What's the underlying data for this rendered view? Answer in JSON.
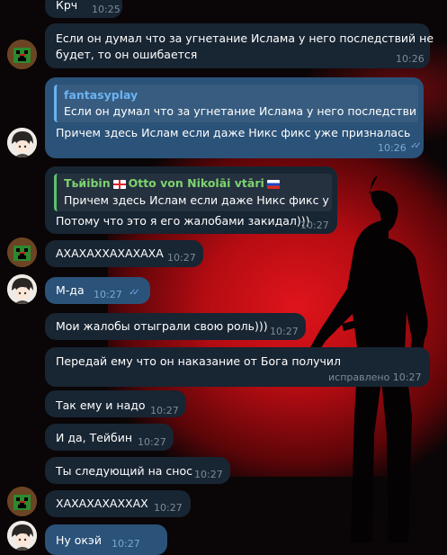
{
  "chat": {
    "messages": [
      {
        "text": "Крч",
        "time": "10:25"
      },
      {
        "text_line1": "Если он думал что за угнетание Ислама у него последствий не",
        "text_line2": "будет, то он ошибается",
        "time": "10:26"
      },
      {
        "reply_name": "fantasyplay",
        "reply_text": "Если он думал что за угнетание Ислама у него последствий н...",
        "text": "Причем здесь Ислам если даже Никс фикс уже призналась",
        "time": "10:26"
      },
      {
        "reply_name_part1": "Тьйibin",
        "reply_name_part2": "Otto von Nikolāi vtāri",
        "reply_text": "Причем здесь Ислам если даже Никс фикс у...",
        "text": "Потому что это я его жалобами закидал)))",
        "time": "10:27"
      },
      {
        "text": "АХАХАХХАХАХАХА",
        "time": "10:27"
      },
      {
        "text": "М-да",
        "time": "10:27"
      },
      {
        "text": "Мои жалобы отыграли свою роль)))",
        "time": "10:27"
      },
      {
        "text": "Передай ему что он наказание от Бога получил",
        "time": "исправлено 10:27"
      },
      {
        "text": "Так ему и надо",
        "time": "10:27"
      },
      {
        "text": "И да, Тейбин",
        "time": "10:27"
      },
      {
        "text": "Ты следующий на снос",
        "time": "10:27"
      },
      {
        "text": "ХАХАХАХАХХАХ",
        "time": "10:27"
      },
      {
        "text": "Ну окэй",
        "time": "10:27"
      }
    ]
  },
  "colors": {
    "incoming_bubble": "#182533",
    "outgoing_bubble": "#2b5278",
    "accent": "#6ab3f3",
    "background_red": "#e0141b"
  },
  "icons": {
    "read_receipt": "double-check-icon"
  }
}
